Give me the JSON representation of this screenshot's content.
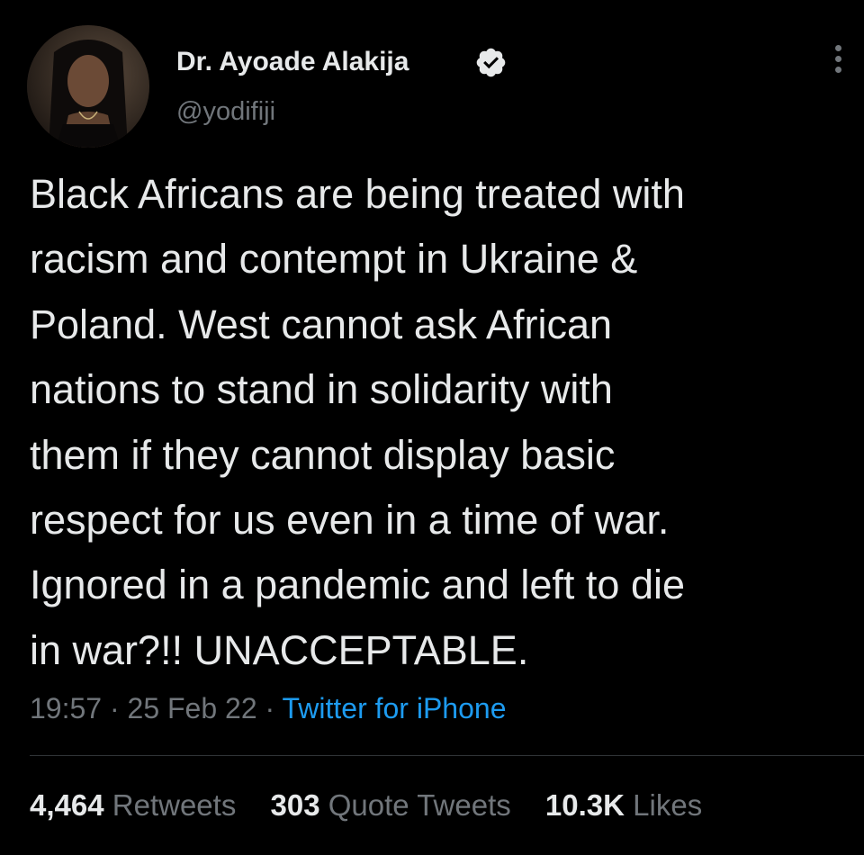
{
  "author": {
    "display_name": "Dr. Ayoade Alakija",
    "handle": "@yodifiji",
    "verified": true,
    "avatar": "profile-photo"
  },
  "tweet": {
    "lines": [
      "Black Africans are being treated with",
      "racism and contempt in Ukraine &",
      "Poland. West cannot ask African",
      "nations to stand in solidarity with",
      "them if they cannot display basic",
      "respect for us even in a time of war.",
      "Ignored in a pandemic and left to die",
      "in war?!! UNACCEPTABLE."
    ],
    "time": "19:57",
    "separator": "·",
    "date": "25 Feb 22",
    "source": "Twitter for iPhone"
  },
  "stats": {
    "retweets": {
      "count": "4,464",
      "label": "Retweets"
    },
    "quote_tweets": {
      "count": "303",
      "label": "Quote Tweets"
    },
    "likes": {
      "count": "10.3K",
      "label": "Likes"
    }
  },
  "icons": {
    "verified": "verified-badge-icon",
    "more": "more-options-icon"
  },
  "colors": {
    "background": "#000000",
    "text": "#e7e9ea",
    "muted": "#71767b",
    "link": "#1d9bf0",
    "divider": "#2f3336"
  }
}
